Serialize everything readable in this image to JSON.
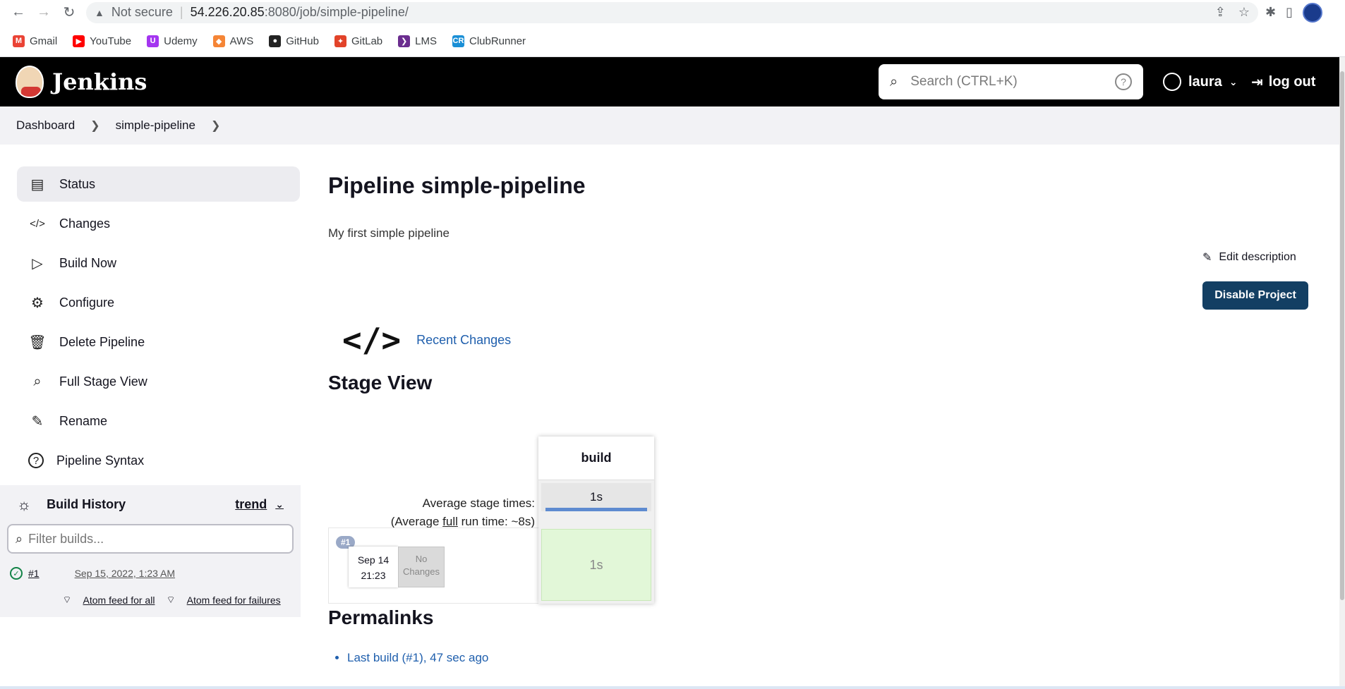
{
  "browser": {
    "security": "Not secure",
    "host": "54.226.20.85",
    "path": ":8080/job/simple-pipeline/",
    "bookmarks": [
      {
        "label": "Gmail",
        "icon": "gmail-icon",
        "color": "#ea4335",
        "glyph": "M"
      },
      {
        "label": "YouTube",
        "icon": "youtube-icon",
        "color": "#ff0000",
        "glyph": "▶"
      },
      {
        "label": "Udemy",
        "icon": "udemy-icon",
        "color": "#a435f0",
        "glyph": "U"
      },
      {
        "label": "AWS",
        "icon": "aws-icon",
        "color": "#f58536",
        "glyph": "◆"
      },
      {
        "label": "GitHub",
        "icon": "github-icon",
        "color": "#222222",
        "glyph": "●"
      },
      {
        "label": "GitLab",
        "icon": "gitlab-icon",
        "color": "#e24329",
        "glyph": "✦"
      },
      {
        "label": "LMS",
        "icon": "lms-icon",
        "color": "#6b2d8f",
        "glyph": "❯"
      },
      {
        "label": "ClubRunner",
        "icon": "clubrunner-icon",
        "color": "#1a8fd6",
        "glyph": "CR"
      }
    ]
  },
  "header": {
    "brand": "Jenkins",
    "search_placeholder": "Search (CTRL+K)",
    "user": "laura",
    "logout": "log out"
  },
  "breadcrumb": [
    "Dashboard",
    "simple-pipeline"
  ],
  "sidebar": {
    "tasks": [
      {
        "label": "Status",
        "icon": "status-icon",
        "glyph": "▤",
        "active": true
      },
      {
        "label": "Changes",
        "icon": "code-icon",
        "glyph": "</>"
      },
      {
        "label": "Build Now",
        "icon": "play-icon",
        "glyph": "▷"
      },
      {
        "label": "Configure",
        "icon": "gear-icon",
        "glyph": "⚙"
      },
      {
        "label": "Delete Pipeline",
        "icon": "trash-icon",
        "glyph": "🗑"
      },
      {
        "label": "Full Stage View",
        "icon": "search-icon",
        "glyph": "⌕"
      },
      {
        "label": "Rename",
        "icon": "pencil-icon",
        "glyph": "✎"
      },
      {
        "label": "Pipeline Syntax",
        "icon": "help-icon",
        "glyph": "?"
      }
    ],
    "build_history": {
      "title": "Build History",
      "trend": "trend",
      "filter_placeholder": "Filter builds...",
      "builds": [
        {
          "number": "#1",
          "date": "Sep 15, 2022, 1:23 AM",
          "status": "success"
        }
      ],
      "feed_all": "Atom feed for all",
      "feed_failures": "Atom feed for failures"
    }
  },
  "main": {
    "title": "Pipeline simple-pipeline",
    "description": "My first simple pipeline",
    "edit_description": "Edit description",
    "disable_button": "Disable Project",
    "recent_changes": "Recent Changes",
    "stage_view_title": "Stage View",
    "stage_view": {
      "stage_name": "build",
      "avg_label": "Average stage times:",
      "avg_full_prefix": "(Average ",
      "avg_full_word": "full",
      "avg_full_suffix": " run time: ~8s)",
      "avg_time": "1s",
      "run_badge": "#1",
      "run_date": "Sep 14",
      "run_time": "21:23",
      "no_changes_1": "No",
      "no_changes_2": "Changes",
      "stage_time": "1s"
    },
    "permalinks_title": "Permalinks",
    "permalinks": [
      "Last build (#1), 47 sec ago"
    ]
  }
}
